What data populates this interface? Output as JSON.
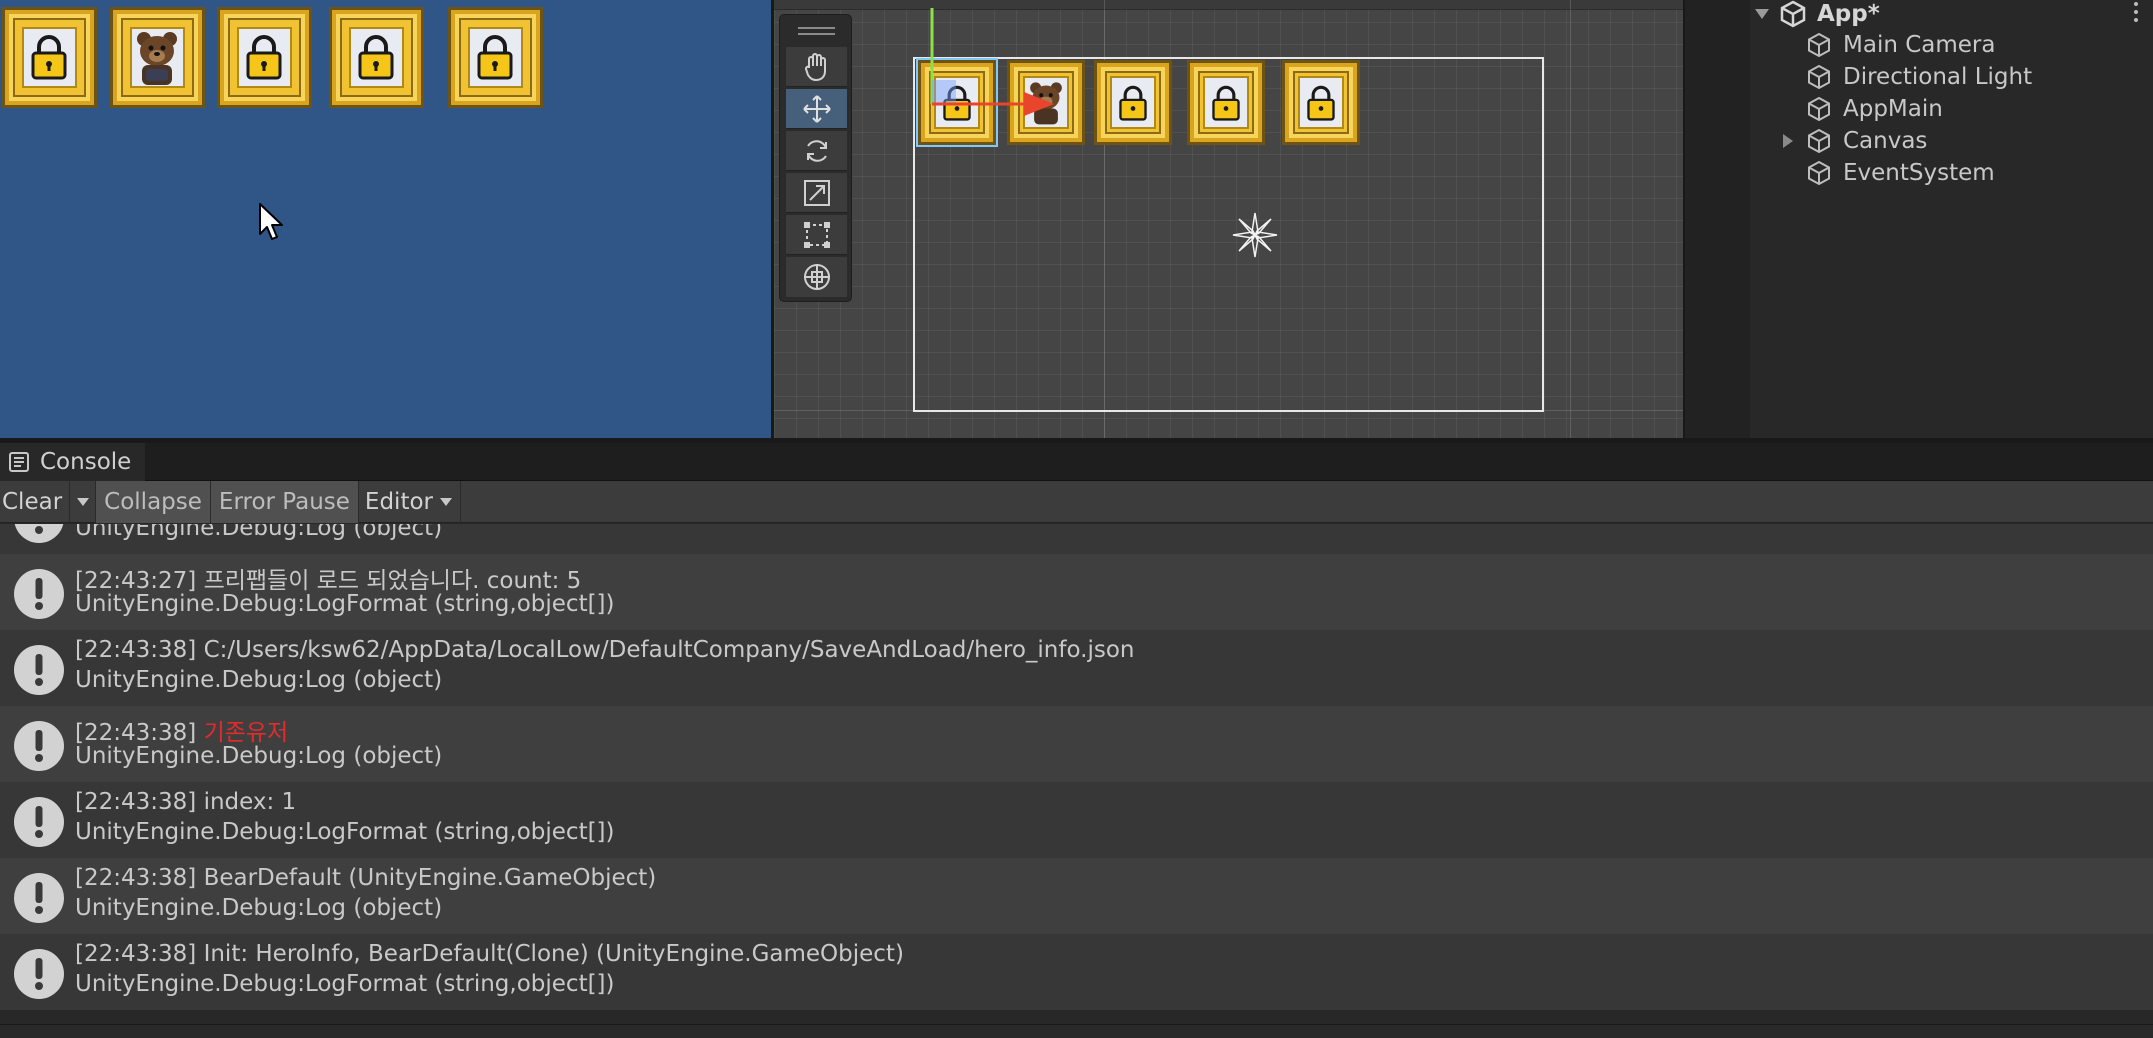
{
  "game_view": {
    "slots": [
      {
        "type": "locked",
        "icon": "padlock-icon"
      },
      {
        "type": "hero",
        "icon": "bear-icon"
      },
      {
        "type": "locked",
        "icon": "padlock-icon"
      },
      {
        "type": "locked",
        "icon": "padlock-icon"
      },
      {
        "type": "locked",
        "icon": "padlock-icon"
      }
    ],
    "background": "#2f5686"
  },
  "scene_view": {
    "tools": [
      "hand-tool-icon",
      "move-tool-icon",
      "rotate-tool-icon",
      "scale-tool-icon",
      "rect-tool-icon",
      "transform-tool-icon"
    ],
    "active_tool": "move-tool-icon"
  },
  "hierarchy": {
    "root": "App*",
    "items": [
      {
        "label": "Main Camera",
        "expandable": false
      },
      {
        "label": "Directional Light",
        "expandable": false
      },
      {
        "label": "AppMain",
        "expandable": false
      },
      {
        "label": "Canvas",
        "expandable": true
      },
      {
        "label": "EventSystem",
        "expandable": false
      }
    ]
  },
  "console": {
    "tab_label": "Console",
    "toolbar": {
      "clear": "Clear",
      "collapse": "Collapse",
      "error_pause": "Error Pause",
      "editor": "Editor"
    },
    "search_placeholder": "",
    "entries": [
      {
        "time": "",
        "message": "",
        "stack": "UnityEngine.Debug:Log (object)",
        "partial": true
      },
      {
        "time": "[22:43:27]",
        "message": "프리팹들이 로드 되었습니다. count: 5",
        "stack": "UnityEngine.Debug:LogFormat (string,object[])"
      },
      {
        "time": "[22:43:38]",
        "message": "C:/Users/ksw62/AppData/LocalLow/DefaultCompany/SaveAndLoad/hero_info.json",
        "stack": "UnityEngine.Debug:Log (object)"
      },
      {
        "time": "[22:43:38]",
        "message": "기존유저",
        "stack": "UnityEngine.Debug:Log (object)",
        "highlight": "#e22b2b"
      },
      {
        "time": "[22:43:38]",
        "message": "index: 1",
        "stack": "UnityEngine.Debug:LogFormat (string,object[])"
      },
      {
        "time": "[22:43:38]",
        "message": "BearDefault (UnityEngine.GameObject)",
        "stack": "UnityEngine.Debug:Log (object)"
      },
      {
        "time": "[22:43:38]",
        "message": "Init: HeroInfo, BearDefault(Clone) (UnityEngine.GameObject)",
        "stack": "UnityEngine.Debug:LogFormat (string,object[])"
      }
    ]
  }
}
